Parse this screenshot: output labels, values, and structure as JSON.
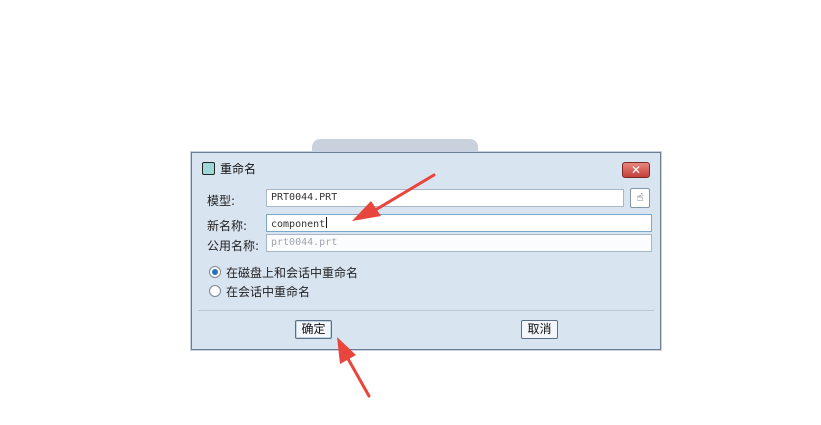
{
  "dialog": {
    "title": "重命名",
    "close_label": "✕",
    "model_label": "模型:",
    "model_value": "PRT0044.PRT",
    "new_name_label": "新名称:",
    "new_name_value": "component",
    "common_name_label": "公用名称:",
    "common_name_value": "prt0044.prt",
    "radio_options": [
      "在磁盘上和会话中重命名",
      "在会话中重命名"
    ],
    "selected_option": 0,
    "ok_label": "确定",
    "cancel_label": "取消",
    "pick_icon": "model-pick-icon"
  },
  "annotations": {
    "arrow_color": "#e8453c"
  }
}
